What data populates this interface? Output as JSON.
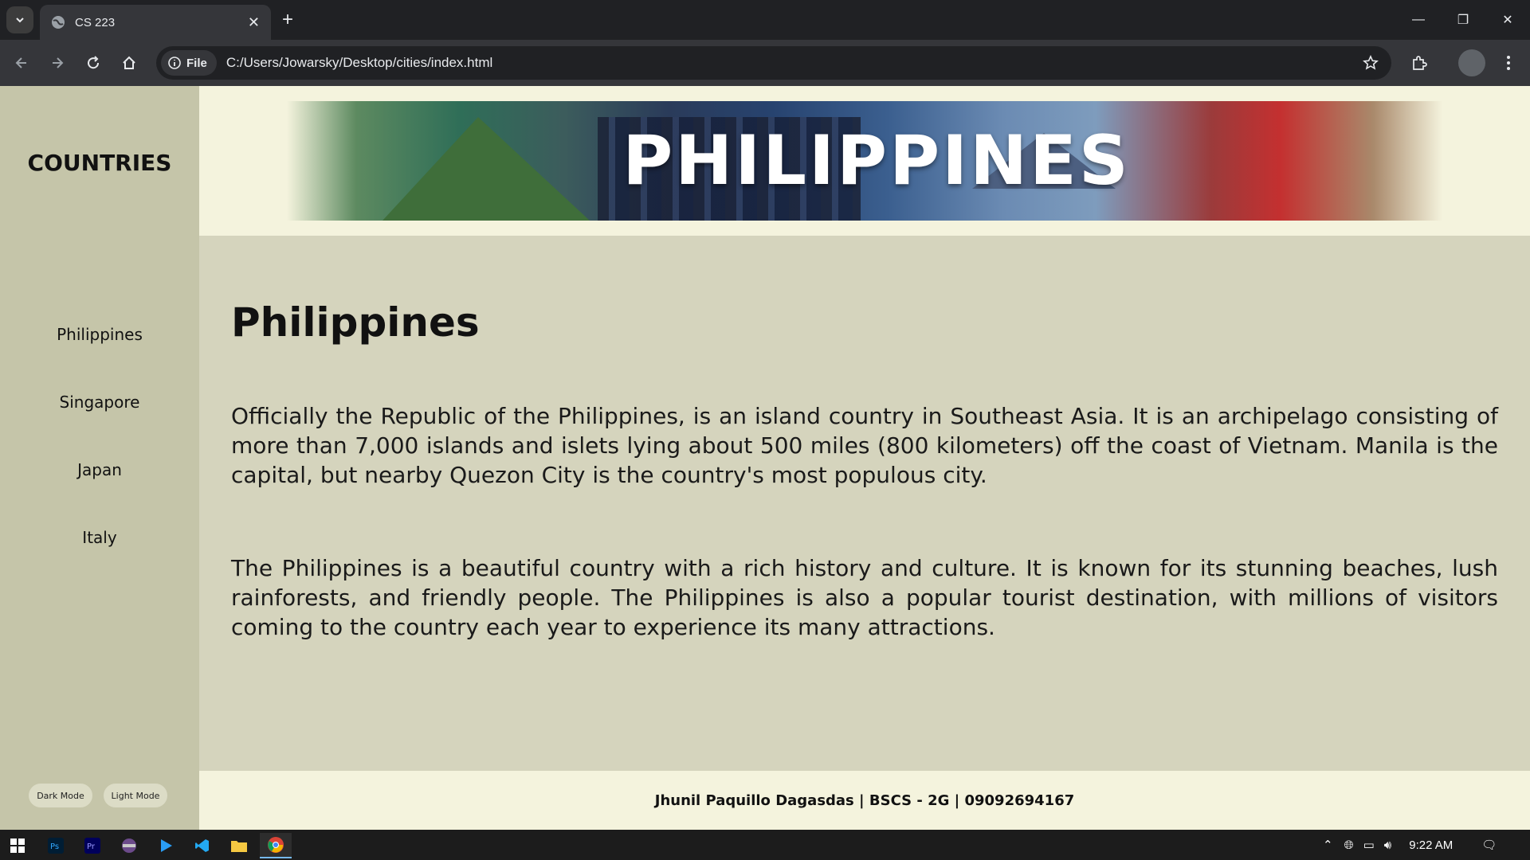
{
  "browser": {
    "tab_title": "CS 223",
    "address": "C:/Users/Jowarsky/Desktop/cities/index.html",
    "scheme_chip": "File"
  },
  "sidebar": {
    "brand": "COUNTRIES",
    "items": [
      {
        "label": "Philippines"
      },
      {
        "label": "Singapore"
      },
      {
        "label": "Japan"
      },
      {
        "label": "Italy"
      }
    ],
    "dark_mode_label": "Dark Mode",
    "light_mode_label": "Light Mode"
  },
  "header": {
    "banner_text": "PHILIPPINES"
  },
  "main": {
    "title": "Philippines",
    "paragraph1": "Officially the Republic of the Philippines, is an island country in Southeast Asia. It is an archipelago consisting of more than 7,000 islands and islets lying about 500 miles (800 kilometers) off the coast of Vietnam. Manila is the capital, but nearby Quezon City is the country's most populous city.",
    "paragraph2": "The Philippines is a beautiful country with a rich history and culture. It is known for its stunning beaches, lush rainforests, and friendly people. The Philippines is also a popular tourist destination, with millions of visitors coming to the country each year to experience its many attractions."
  },
  "footer": {
    "text": "Jhunil Paquillo Dagasdas | BSCS - 2G | 09092694167"
  },
  "taskbar": {
    "time": "9:22 AM"
  }
}
